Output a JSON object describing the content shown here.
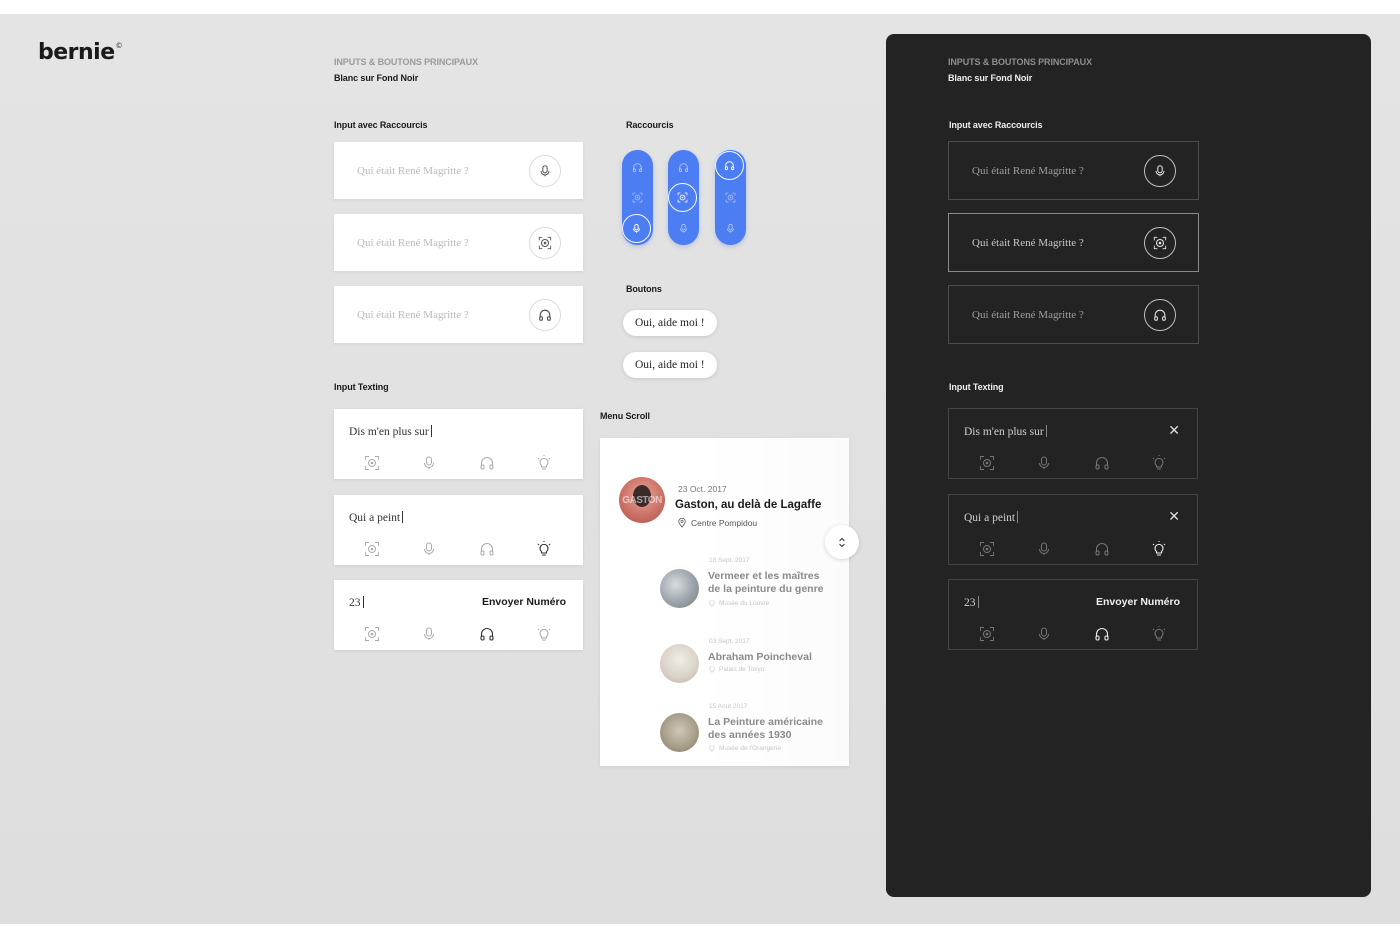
{
  "brand": {
    "name": "bernie",
    "mark": "©"
  },
  "light": {
    "section_title": "INPUTS & BOUTONS PRINCIPAUX",
    "section_subtitle": "Blanc sur Fond Noir",
    "input_shortcuts_label": "Input avec Raccourcis",
    "shortcut_inputs": [
      {
        "placeholder": "Qui était René Magritte ?",
        "icon": "mic-icon"
      },
      {
        "placeholder": "Qui était René Magritte ?",
        "icon": "scan-icon"
      },
      {
        "placeholder": "Qui était René Magritte ?",
        "icon": "headphones-icon"
      }
    ],
    "input_texting_label": "Input Texting",
    "texting": [
      {
        "value": "Dis m'en plus sur",
        "active_icon": "none"
      },
      {
        "value": "Qui a peint",
        "active_icon": "bulb-icon"
      },
      {
        "value": "23",
        "action": "Envoyer Numéro",
        "active_icon": "headphones-icon"
      }
    ]
  },
  "shortcuts": {
    "label": "Raccourcis",
    "pills": [
      {
        "active": "mic-icon"
      },
      {
        "active": "scan-icon"
      },
      {
        "active": "headphones-icon"
      }
    ],
    "color": "#4c7df2"
  },
  "buttons": {
    "label": "Boutons",
    "items": [
      "Oui, aide moi !",
      "Oui, aide moi !"
    ]
  },
  "menu_scroll": {
    "label": "Menu Scroll",
    "items": [
      {
        "date": "23 Oct. 2017",
        "title": "Gaston, au delà de Lagaffe",
        "place": "Centre Pompidou",
        "thumb_text": "GASTON"
      },
      {
        "date": "18 Sept. 2017",
        "title": "Vermeer et les maîtres de la peinture du genre",
        "place": "Musée du Louvre"
      },
      {
        "date": "03 Sept. 2017",
        "title": "Abraham Poincheval",
        "place": "Palais de Tokyo"
      },
      {
        "date": "15 Aout 2017",
        "title": "La Peinture américaine des années 1930",
        "place": "Musée de l'Orangerie"
      }
    ]
  },
  "dark": {
    "section_title": "INPUTS & BOUTONS PRINCIPAUX",
    "section_subtitle": "Blanc sur Fond Noir",
    "input_shortcuts_label": "Input avec Raccourcis",
    "shortcut_inputs": [
      {
        "placeholder": "Qui était René Magritte ?",
        "icon": "mic-icon"
      },
      {
        "placeholder": "Qui était René Magritte ?",
        "icon": "scan-icon"
      },
      {
        "placeholder": "Qui était René Magritte ?",
        "icon": "headphones-icon"
      }
    ],
    "input_texting_label": "Input Texting",
    "texting": [
      {
        "value": "Dis m'en plus sur",
        "close": "✕"
      },
      {
        "value": "Qui a peint",
        "close": "✕"
      },
      {
        "value": "23",
        "action": "Envoyer Numéro"
      }
    ],
    "background": "#232323"
  }
}
